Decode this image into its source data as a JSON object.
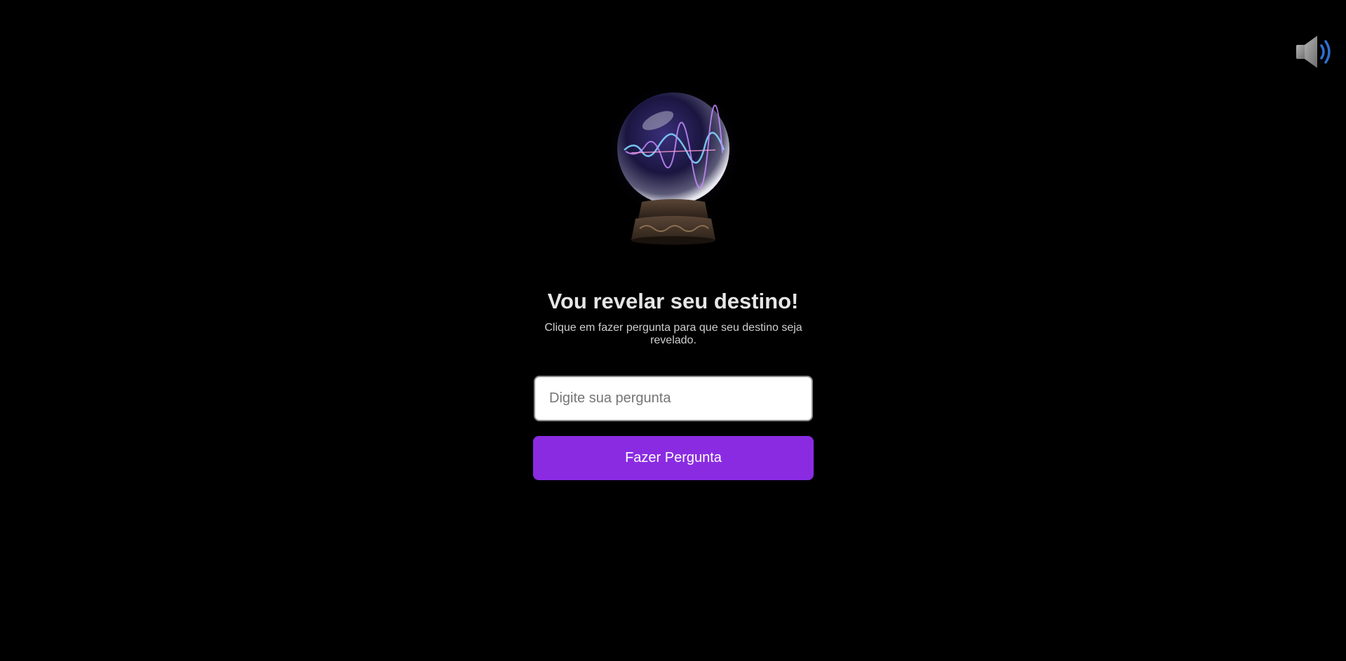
{
  "sound": {
    "icon": "speaker-volume-icon",
    "speaker_color": "#8e8e8e",
    "wave_color": "#2f6fd1"
  },
  "hero": {
    "image_icon": "crystal-ball-icon",
    "glow_color": "#7b3fd6"
  },
  "main": {
    "title": "Vou revelar seu destino!",
    "subtitle": "Clique em fazer pergunta para que seu destino seja revelado.",
    "question_input": {
      "value": "",
      "placeholder": "Digite sua pergunta"
    },
    "ask_button_label": "Fazer Pergunta"
  },
  "colors": {
    "background": "#000000",
    "accent": "#8a2be2",
    "title_text": "#e6e6e6"
  }
}
